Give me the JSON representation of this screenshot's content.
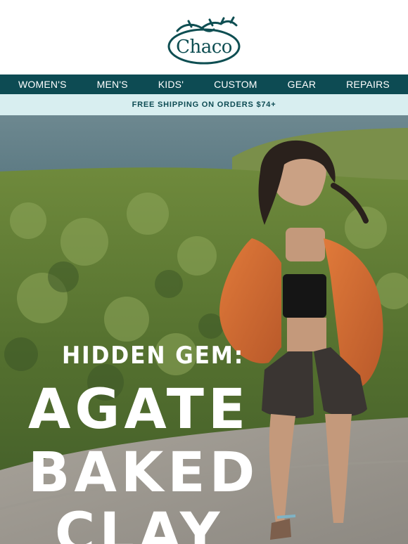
{
  "brand": {
    "name": "Chaco",
    "logo_icon": "lizard-icon"
  },
  "nav": {
    "items": [
      {
        "label": "WOMEN'S"
      },
      {
        "label": "MEN'S"
      },
      {
        "label": "KIDS'"
      },
      {
        "label": "CUSTOM"
      },
      {
        "label": "GEAR"
      },
      {
        "label": "REPAIRS"
      }
    ]
  },
  "promo": {
    "text": "FREE SHIPPING ON ORDERS $74+"
  },
  "hero": {
    "kicker": "HIDDEN GEM:",
    "headline_lines": [
      "AGATE",
      "BAKED",
      "CLAY"
    ]
  },
  "colors": {
    "nav_bg": "#0d4b53",
    "promo_bg": "#d8eef0",
    "brand": "#0e4e52"
  }
}
